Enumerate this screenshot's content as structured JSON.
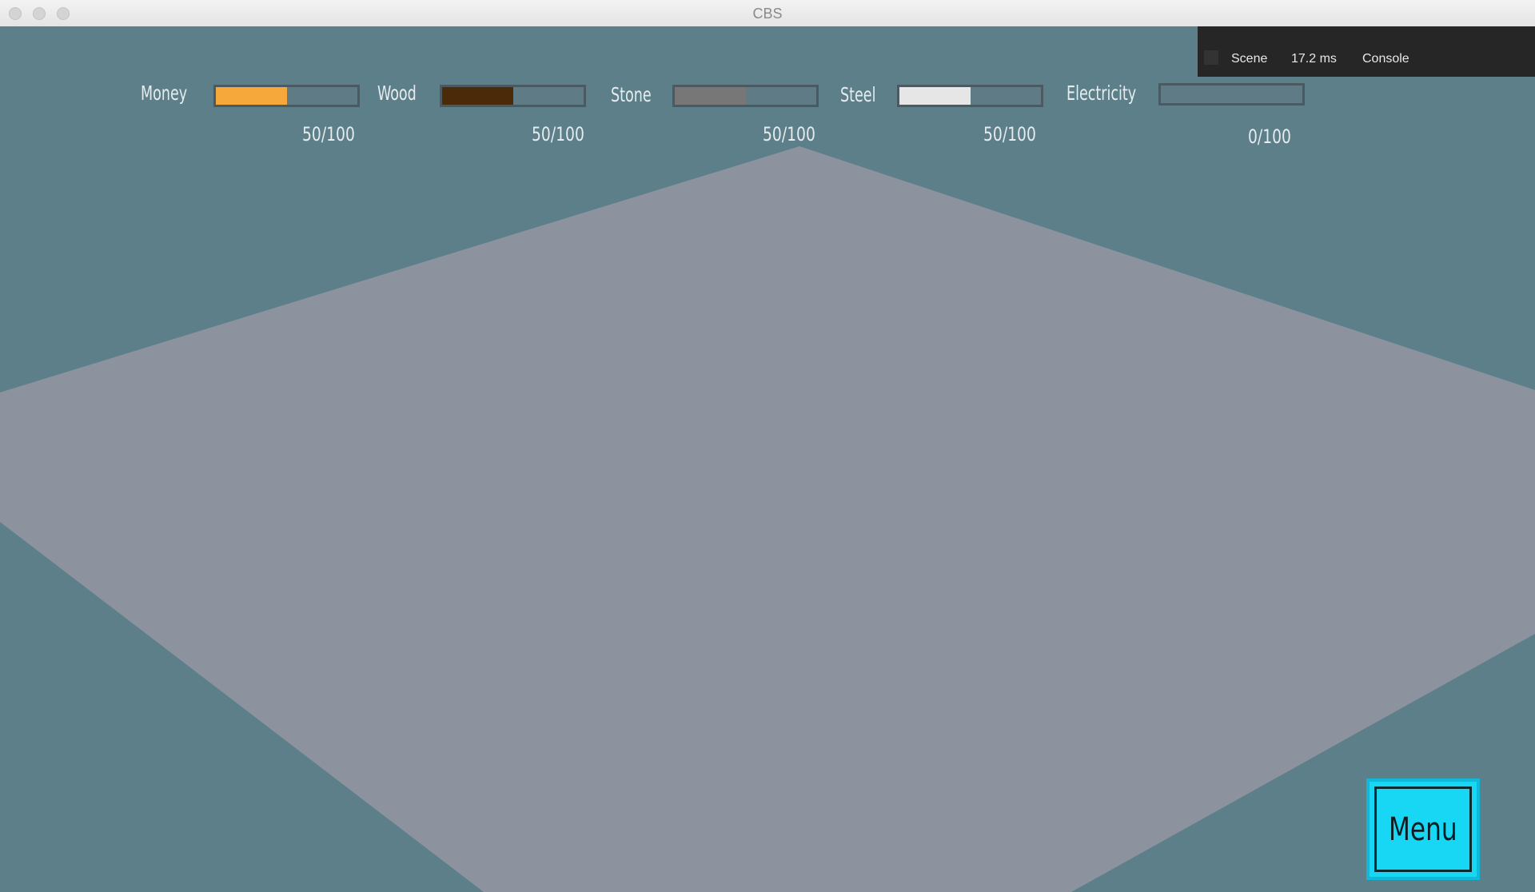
{
  "window": {
    "title": "CBS"
  },
  "debug": {
    "scene_label": "Scene",
    "frame_time": "17.2 ms",
    "console_label": "Console"
  },
  "resources": [
    {
      "label": "Money",
      "value_text": "50/100",
      "fraction": 0.5,
      "color": "#f6a83a"
    },
    {
      "label": "Wood",
      "value_text": "50/100",
      "fraction": 0.5,
      "color": "#4a2a08"
    },
    {
      "label": "Stone",
      "value_text": "50/100",
      "fraction": 0.5,
      "color": "#777777"
    },
    {
      "label": "Steel",
      "value_text": "50/100",
      "fraction": 0.5,
      "color": "#e6e6e6"
    },
    {
      "label": "Electricity",
      "value_text": "0/100",
      "fraction": 0.0,
      "color": "#ffd400"
    }
  ],
  "menu": {
    "label": "Menu"
  },
  "colors": {
    "sky": "#5c7f8a",
    "ground": "#8c939e",
    "menu_bg": "#18d7f5"
  }
}
